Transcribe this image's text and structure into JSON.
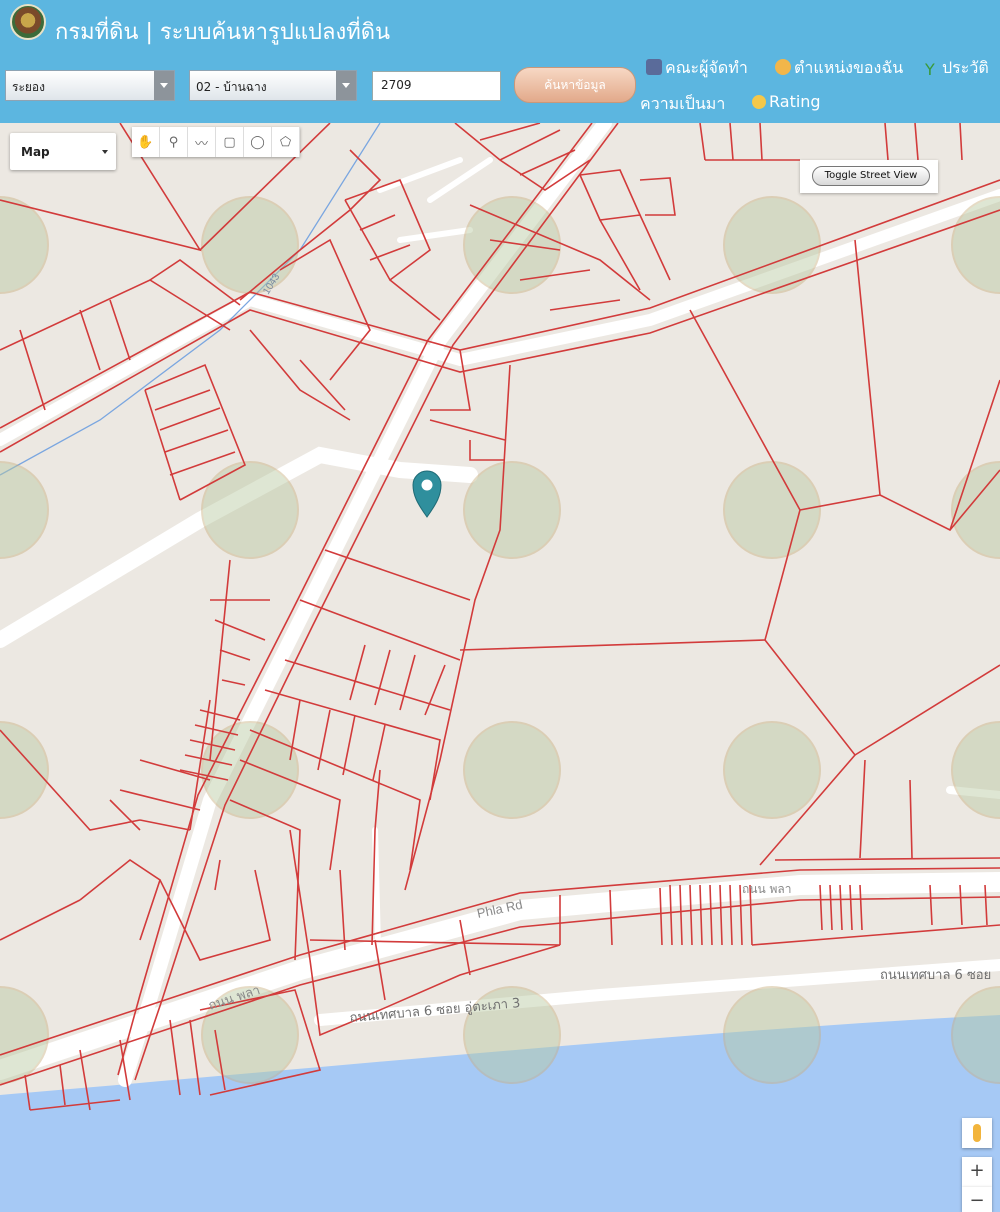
{
  "header": {
    "site_title": "กรมที่ดิน | ระบบค้นหารูปแปลงที่ดิน",
    "province_select": "ระยอง",
    "district_select": "02 - บ้านฉาง",
    "parcel_number": "2709",
    "search_button": "ค้นหาข้อมูล",
    "links": {
      "team": "คณะผู้จัดทำ",
      "my_location": "ตำแหน่งของฉัน",
      "history": "ประวัติ",
      "history_cont": "ความเป็นมา",
      "rating": "Rating"
    }
  },
  "map": {
    "map_type": "Map",
    "toggle_street_view": "Toggle Street View",
    "labels": {
      "phla_rd": "Phla Rd",
      "thanon_phla": "ถนน พลา",
      "thanon_phla_2": "ถนน พลา",
      "soi_3": "ถนนเทศบาล 6 ซอย อู่ตะเภา 3",
      "soi_edge": "ถนนเทศบาล 6 ซอย",
      "road_code": "1043"
    },
    "zoom_in": "+",
    "zoom_out": "−",
    "tools": [
      "hand-icon",
      "marker-icon",
      "polyline-icon",
      "rectangle-icon",
      "circle-icon",
      "polygon-icon"
    ],
    "colors": {
      "parcel": "#d23b3b",
      "water": "#a6c9f5",
      "land": "#ece8e2",
      "road": "#ffffff",
      "marker": "#2f8f9d"
    }
  }
}
